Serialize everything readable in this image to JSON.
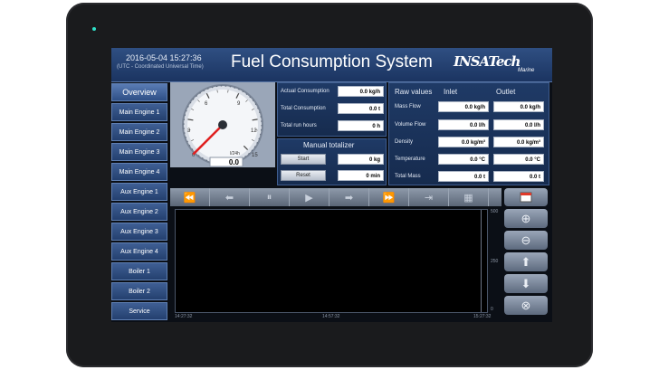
{
  "header": {
    "datetime": "2016-05-04 15:27:36",
    "timezone": "(UTC - Coordinated Universal Time)",
    "title": "Fuel Consumption System",
    "logo": "INSATech",
    "logo_sub": "Marine"
  },
  "sidebar": {
    "items": [
      {
        "label": "Overview"
      },
      {
        "label": "Main Engine 1"
      },
      {
        "label": "Main Engine 2"
      },
      {
        "label": "Main Engine 3"
      },
      {
        "label": "Main Engine 4"
      },
      {
        "label": "Aux Engine 1"
      },
      {
        "label": "Aux Engine 2"
      },
      {
        "label": "Aux Engine 3"
      },
      {
        "label": "Aux Engine 4"
      },
      {
        "label": "Boiler 1"
      },
      {
        "label": "Boiler 2"
      },
      {
        "label": "Service"
      }
    ]
  },
  "gauge": {
    "ticks": [
      "3",
      "6",
      "9",
      "12",
      "15"
    ],
    "zero": "0",
    "unit": "l/24h",
    "value": "0.0",
    "needle_value": 0,
    "max": 15
  },
  "consumption": {
    "actual_label": "Actual Consumption",
    "actual_value": "0.0 kg/h",
    "total_label": "Total Consumption",
    "total_value": "0.0 t",
    "runhours_label": "Total run hours",
    "runhours_value": "0 h"
  },
  "totalizer": {
    "title": "Manual totalizer",
    "start_label": "Start",
    "start_value": "0 kg",
    "reset_label": "Reset",
    "reset_value": "0 min"
  },
  "raw": {
    "title": "Raw values",
    "inlet_header": "Inlet",
    "outlet_header": "Outlet",
    "rows": [
      {
        "label": "Mass Flow",
        "inlet": "0.0 kg/h",
        "outlet": "0.0 kg/h"
      },
      {
        "label": "Volume Flow",
        "inlet": "0.0 l/h",
        "outlet": "0.0 l/h"
      },
      {
        "label": "Density",
        "inlet": "0.0 kg/m³",
        "outlet": "0.0 kg/m³"
      },
      {
        "label": "Temperature",
        "inlet": "0.0 °C",
        "outlet": "0.0 °C"
      },
      {
        "label": "Total Mass",
        "inlet": "0.0 t",
        "outlet": "0.0 t"
      }
    ]
  },
  "trend": {
    "x_ticks": [
      "14:27:32",
      "14:57:32",
      "15:27:32"
    ],
    "y_ticks": [
      "500",
      "250",
      "0"
    ]
  },
  "nav_icons": [
    "rewind-icon",
    "step-back-icon",
    "pause-icon",
    "play-icon",
    "step-forward-icon",
    "fast-forward-icon",
    "skip-end-icon",
    "grid-icon",
    "calendar-icon"
  ],
  "side_icons": [
    "zoom-in-icon",
    "zoom-out-icon",
    "arrow-up-icon",
    "arrow-down-icon",
    "close-icon"
  ],
  "colors": {
    "accent": "#1b3461",
    "needle": "#e02020",
    "led": "#2fe0c8"
  }
}
